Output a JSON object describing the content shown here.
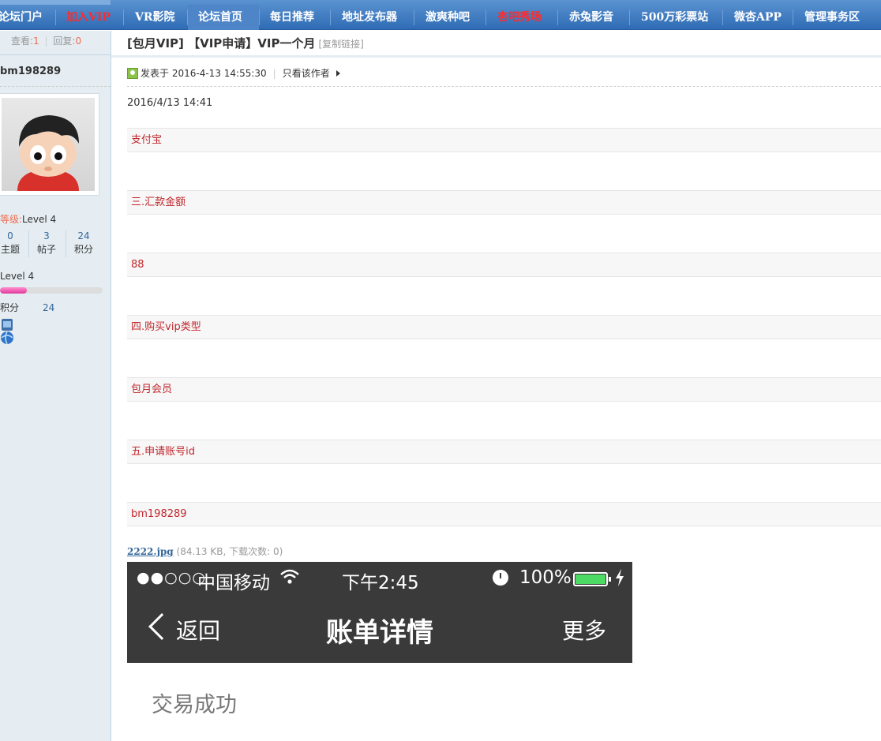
{
  "nav": {
    "items": [
      {
        "label": "论坛门户",
        "style": "normal"
      },
      {
        "label": "加入VIP",
        "style": "red"
      },
      {
        "label": "VR影院",
        "style": "normal"
      },
      {
        "label": "论坛首页",
        "style": "active"
      },
      {
        "label": "每日推荐",
        "style": "normal"
      },
      {
        "label": "地址发布器",
        "style": "normal"
      },
      {
        "label": "激爽种吧",
        "style": "normal"
      },
      {
        "label": "杏吧秀场",
        "style": "red"
      },
      {
        "label": "赤兔影音",
        "style": "normal"
      },
      {
        "label": "500万彩票站",
        "style": "normal"
      },
      {
        "label": "微杏APP",
        "style": "normal"
      },
      {
        "label": "管理事务区",
        "style": "normal"
      }
    ]
  },
  "sidebar": {
    "views_label": "查看:",
    "views": "1",
    "replies_label": "回复:",
    "replies": "0",
    "author": "bm198289",
    "level_key": "等级:",
    "level_value": "Level 4",
    "stats": [
      {
        "value": "0",
        "label": "主题"
      },
      {
        "value": "3",
        "label": "帖子"
      },
      {
        "value": "24",
        "label": "积分"
      }
    ],
    "level_bar_label": "Level 4",
    "level_progress": 0.26,
    "score_label": "积分",
    "score_value": "24"
  },
  "thread": {
    "title": "[包月VIP] 【VIP申请】VIP一个月",
    "copy_link": "[复制链接]",
    "posted_prefix": "发表于",
    "posted_at": "2016-4-13 14:55:30",
    "only_author": "只看该作者",
    "date_line": "2016/4/13  14:41",
    "fields": [
      "支付宝",
      "三.汇款金额",
      "88",
      "四.购买vip类型",
      "包月会员",
      "五.申请账号id",
      "bm198289"
    ]
  },
  "attachment": {
    "filename": "2222.jpg",
    "info": "(84.13 KB, 下载次数: 0)"
  },
  "phone": {
    "signal": "●●○○○",
    "carrier": "中国移动",
    "time": "下午2:45",
    "battery": "100%",
    "back": "返回",
    "title": "账单详情",
    "more": "更多",
    "status": "交易成功"
  },
  "colors": {
    "nav_bg": "#2f6cb5",
    "nav_red": "#ff2a2a",
    "field_text": "#c0272d",
    "sidebar_bg": "#e5edf2",
    "link": "#336699",
    "battery": "#4cd964"
  }
}
